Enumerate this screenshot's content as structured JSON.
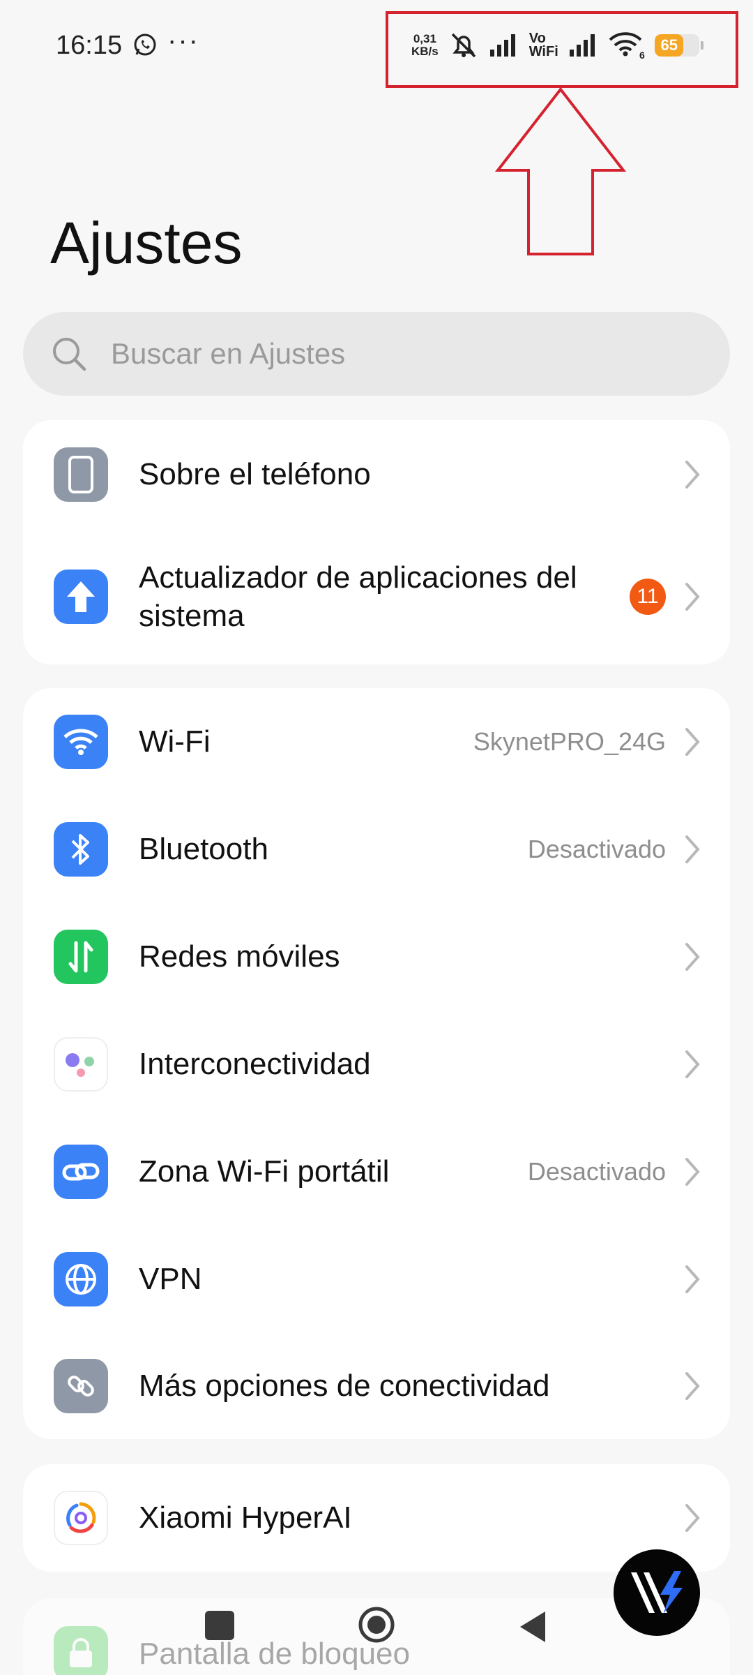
{
  "status_bar": {
    "time": "16:15",
    "net_speed_value": "0,31",
    "net_speed_unit": "KB/s",
    "vo": "Vo",
    "wifi_call": "WiFi",
    "wifi_sub": "6",
    "battery": "65",
    "battery_level": 0.65,
    "icons": [
      "whatsapp-icon",
      "more-dots-icon",
      "bell-muted-icon",
      "signal-icon",
      "signal-icon",
      "wifi-icon",
      "battery-icon"
    ]
  },
  "page": {
    "title": "Ajustes"
  },
  "search": {
    "placeholder": "Buscar en Ajustes"
  },
  "groups": {
    "system": [
      {
        "label": "Sobre el teléfono",
        "icon": "phone-icon"
      },
      {
        "label": "Actualizador de aplicaciones del sistema",
        "icon": "update-arrow-icon",
        "badge": "11"
      }
    ],
    "connectivity": [
      {
        "label": "Wi-Fi",
        "value": "SkynetPRO_24G",
        "icon": "wifi-icon"
      },
      {
        "label": "Bluetooth",
        "value": "Desactivado",
        "icon": "bluetooth-icon"
      },
      {
        "label": "Redes móviles",
        "icon": "mobile-data-icon"
      },
      {
        "label": "Interconectividad",
        "icon": "interconnectivity-icon"
      },
      {
        "label": "Zona Wi-Fi portátil",
        "value": "Desactivado",
        "icon": "hotspot-link-icon"
      },
      {
        "label": "VPN",
        "icon": "globe-icon"
      },
      {
        "label": "Más opciones de conectividad",
        "icon": "more-connectivity-icon"
      }
    ],
    "ai": [
      {
        "label": "Xiaomi HyperAI",
        "icon": "hyperai-icon"
      }
    ],
    "partial": [
      {
        "label": "Pantalla de bloqueo",
        "icon": "lock-icon"
      }
    ]
  },
  "colors": {
    "accent_blue": "#3b82f6",
    "green": "#22c55e",
    "gray_icon": "#8e98a6",
    "badge_orange": "#f25a14",
    "battery_yellow": "#f5a623",
    "annotation_red": "#d4232f"
  }
}
